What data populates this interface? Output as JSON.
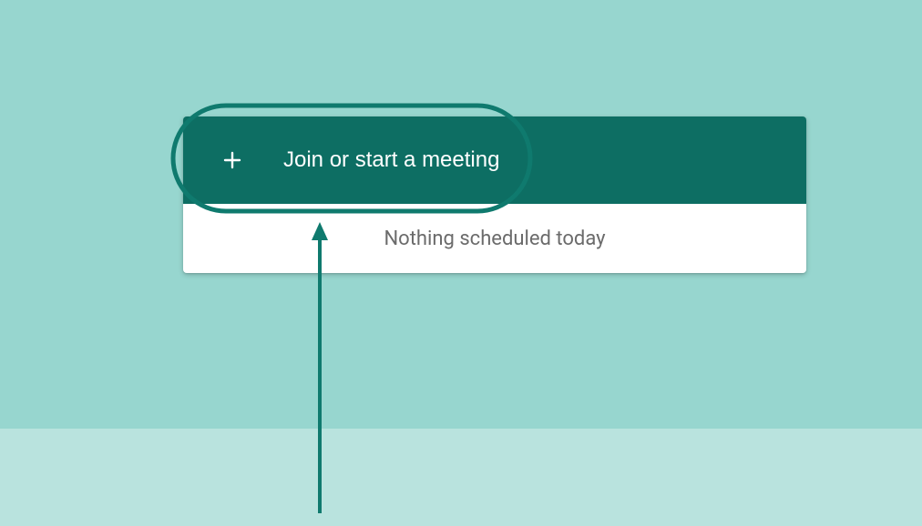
{
  "meeting_card": {
    "join_button_label": "Join or start a meeting",
    "schedule_text": "Nothing scheduled today"
  },
  "colors": {
    "bg_upper": "#97d6cf",
    "bg_lower": "#b9e3de",
    "button_bg": "#0d6e63",
    "schedule_text": "#6b6b6b",
    "annotation": "#0f7a6e"
  }
}
